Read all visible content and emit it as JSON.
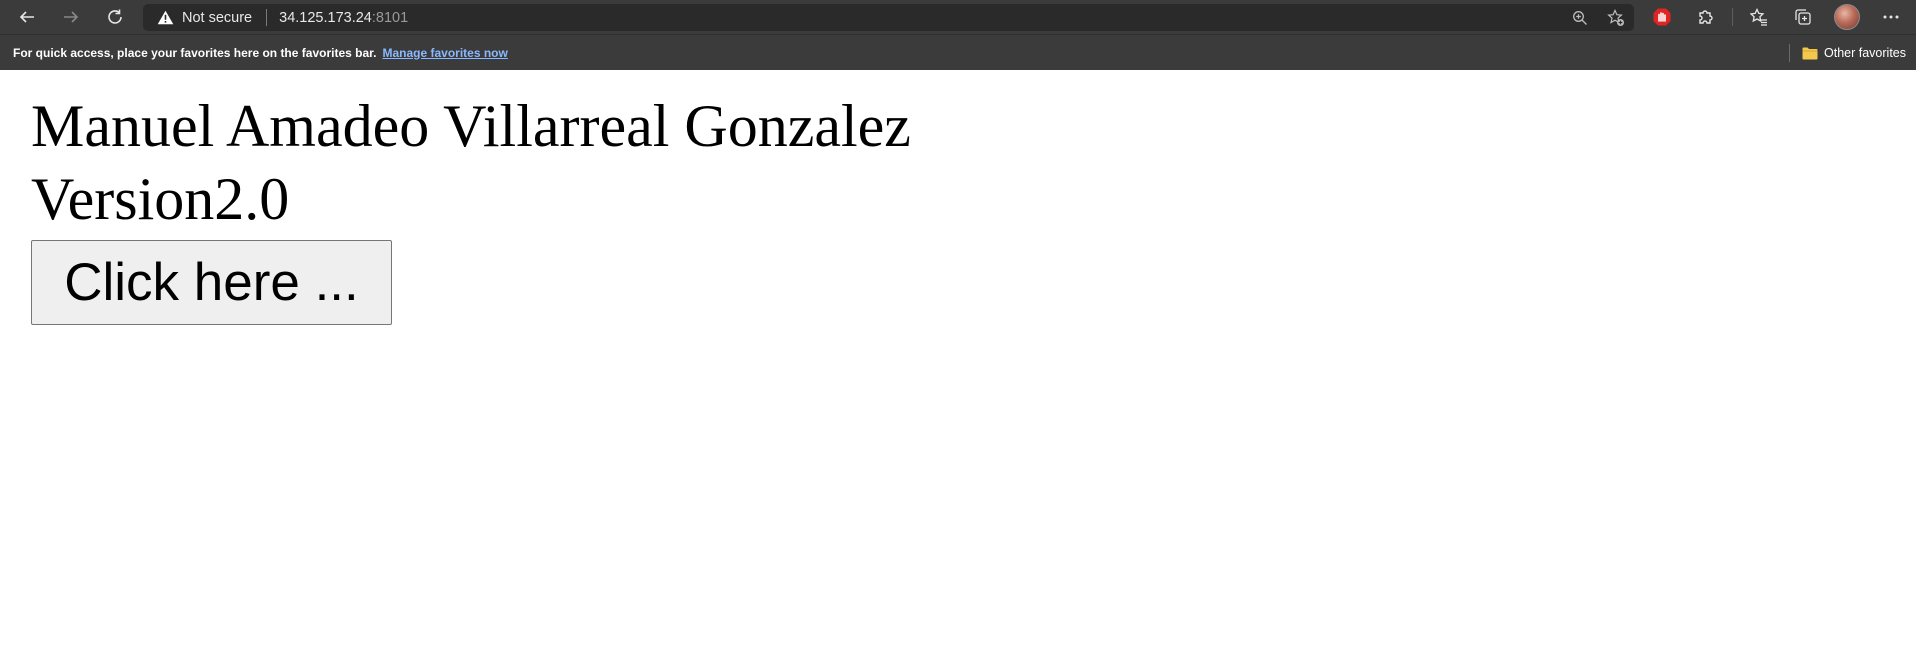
{
  "browser": {
    "security_label": "Not secure",
    "url_host": "34.125.173.24",
    "url_port": ":8101",
    "nav_icons": [
      "back-icon",
      "forward-icon",
      "refresh-icon"
    ],
    "address_icons": [
      "zoom-icon",
      "add-favorite-icon"
    ],
    "toolbar_icons": [
      "ad-blocker-extension-icon",
      "extensions-icon",
      "favorites-icon",
      "collections-icon",
      "profile-avatar",
      "more-icon"
    ]
  },
  "favorites_bar": {
    "message": "For quick access, place your favorites here on the favorites bar.",
    "link": "Manage favorites now",
    "other_favorites": "Other favorites"
  },
  "page": {
    "name": "Manuel Amadeo Villarreal Gonzalez",
    "version": "Version2.0",
    "button_label": "Click here ..."
  },
  "colors": {
    "browser_chrome": "#3b3b3b",
    "address_bar": "#2a2a2a",
    "link": "#8ab8ff",
    "page_background": "#ffffff",
    "button_background": "#efefef",
    "extension_icon": "#e02424",
    "folder_icon": "#f2c94c"
  }
}
